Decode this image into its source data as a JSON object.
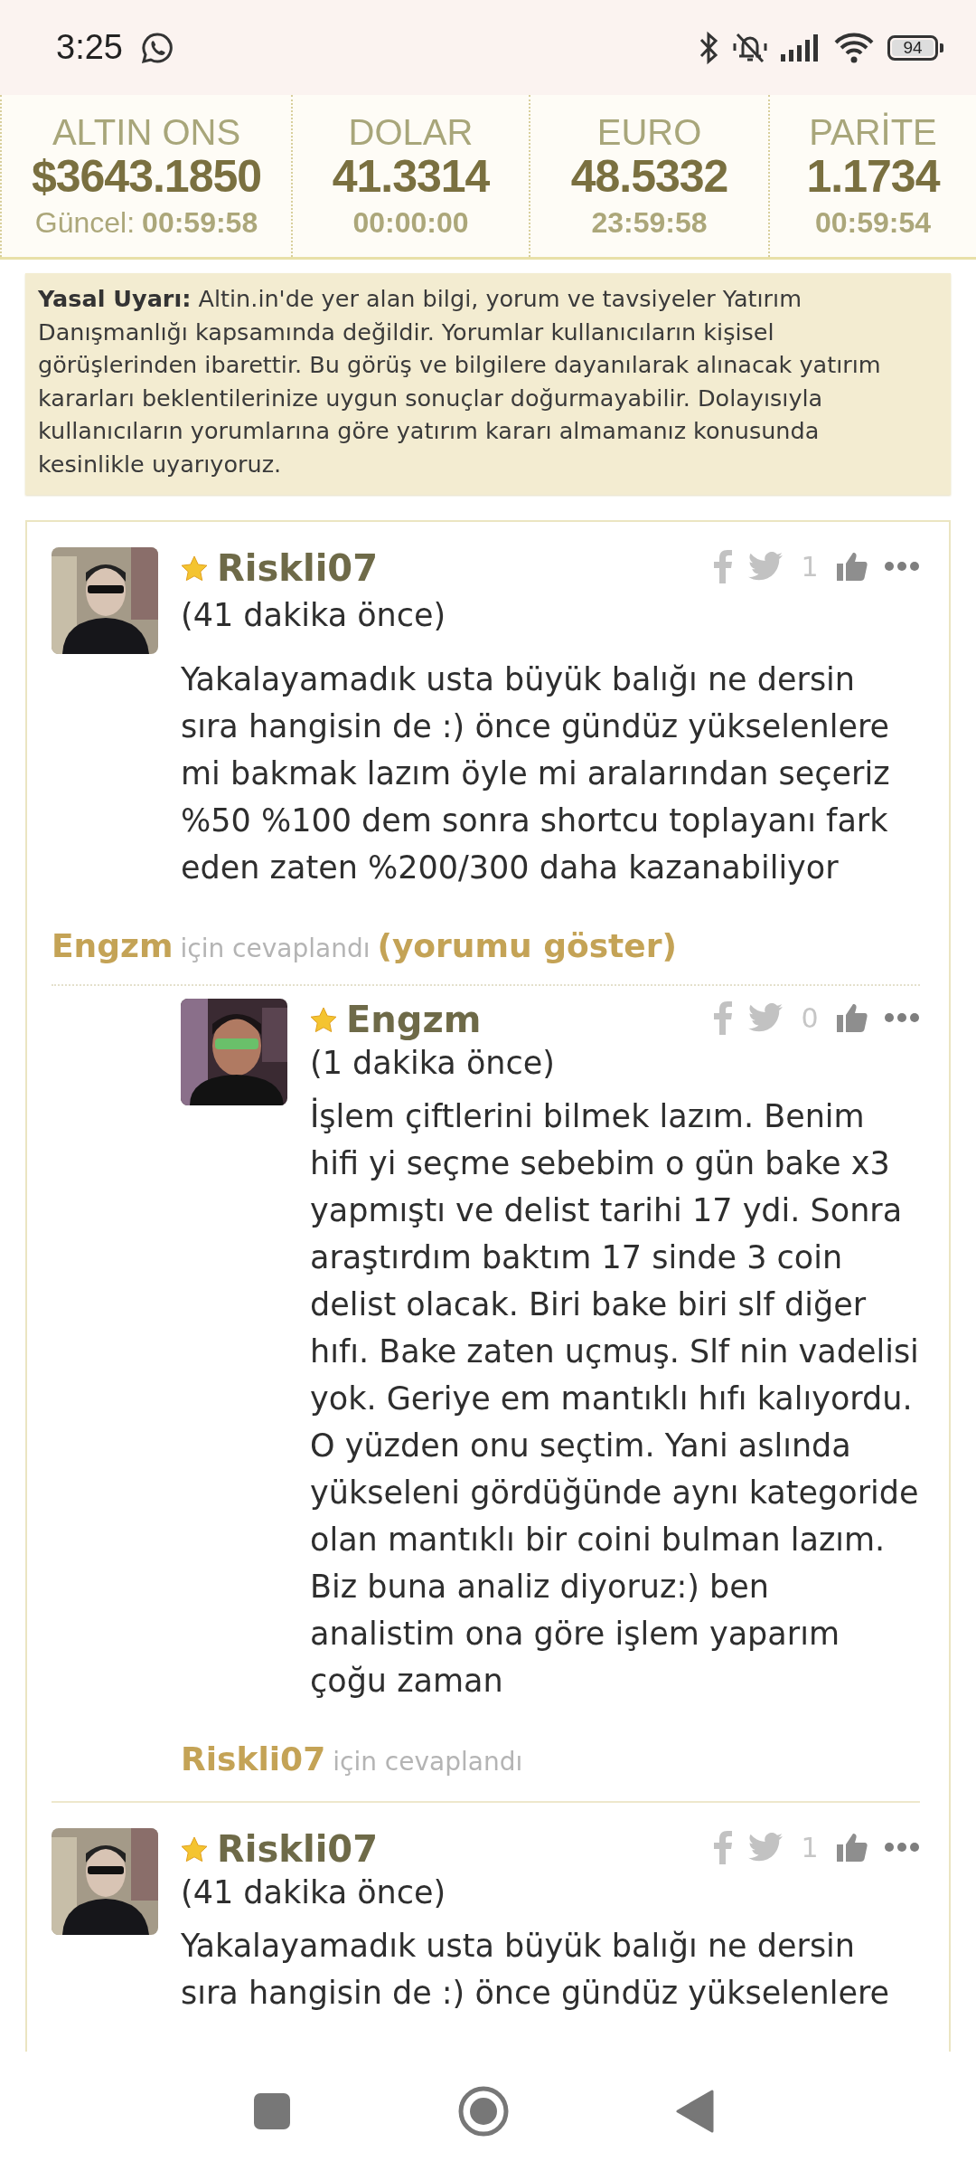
{
  "status_bar": {
    "time": "3:25",
    "battery": "94"
  },
  "ticker": [
    {
      "label": "ALTIN ONS",
      "value": "$3643.1850",
      "time_prefix": "Güncel:",
      "time": "00:59:58"
    },
    {
      "label": "DOLAR",
      "value": "41.3314",
      "time": "00:00:00"
    },
    {
      "label": "EURO",
      "value": "48.5332",
      "time": "23:59:58"
    },
    {
      "label": "PARİTE",
      "value": "1.1734",
      "time": "00:59:54"
    }
  ],
  "legal_notice": "**Yasal Uyarı:** Altin.in'de yer alan bilgi, yorum ve tavsiyeler Yatırım Danışmanlığı kapsamında değildir. Yorumlar kullanıcıların kişisel görüşlerinden ibarettir. Bu görüş ve bilgilere dayanılarak alınacak yatırım kararları beklentilerinize uygun sonuçlar doğurmayabilir. Dolayısıyla kullanıcıların yorumlarına göre yatırım kararı almamanız konusunda kesinlikle uyarıyoruz.",
  "comments": [
    {
      "kind": "thread",
      "author": "Riskli07",
      "time": "(41 dakika önce)",
      "likes": "1",
      "text": "Yakalayamadık usta büyük balığı ne dersin sıra hangisin de :) önce gündüz yükselenlere mi bakmak lazım öyle mi aralarından seçeriz %50 %100 dem sonra shortcu toplayanı fark eden zaten %200/300 daha kazanabiliyor",
      "reply_note": {
        "name": "Engzm",
        "label": "için cevaplandı",
        "link": "(yorumu göster)"
      },
      "children": [
        {
          "kind": "reply",
          "author": "Engzm",
          "time": "(1 dakika önce)",
          "likes": "0",
          "text": "İşlem çiftlerini bilmek lazım. Benim hifi yi seçme sebebim o gün bake x3 yapmıştı ve delist tarihi 17 ydi. Sonra araştırdım baktım 17 sinde 3 coin delist olacak. Biri bake biri slf diğer hıfı. Bake zaten uçmuş. Slf nin vadelisi yok. Geriye em mantıklı hıfı kalıyordu. O yüzden onu seçtim. Yani aslında yükseleni gördüğünde aynı kategoride olan mantıklı bir coini bulman lazım. Biz buna analiz diyoruz:) ben analistim ona göre işlem yaparım çoğu zaman",
          "reply_note": {
            "name": "Riskli07",
            "label": "için cevaplandı"
          }
        }
      ]
    },
    {
      "kind": "comment",
      "author": "Riskli07",
      "time": "(41 dakika önce)",
      "likes": "1",
      "text": "Yakalayamadık usta büyük balığı ne dersin sıra hangisin de :) önce gündüz yükselenlere"
    }
  ]
}
